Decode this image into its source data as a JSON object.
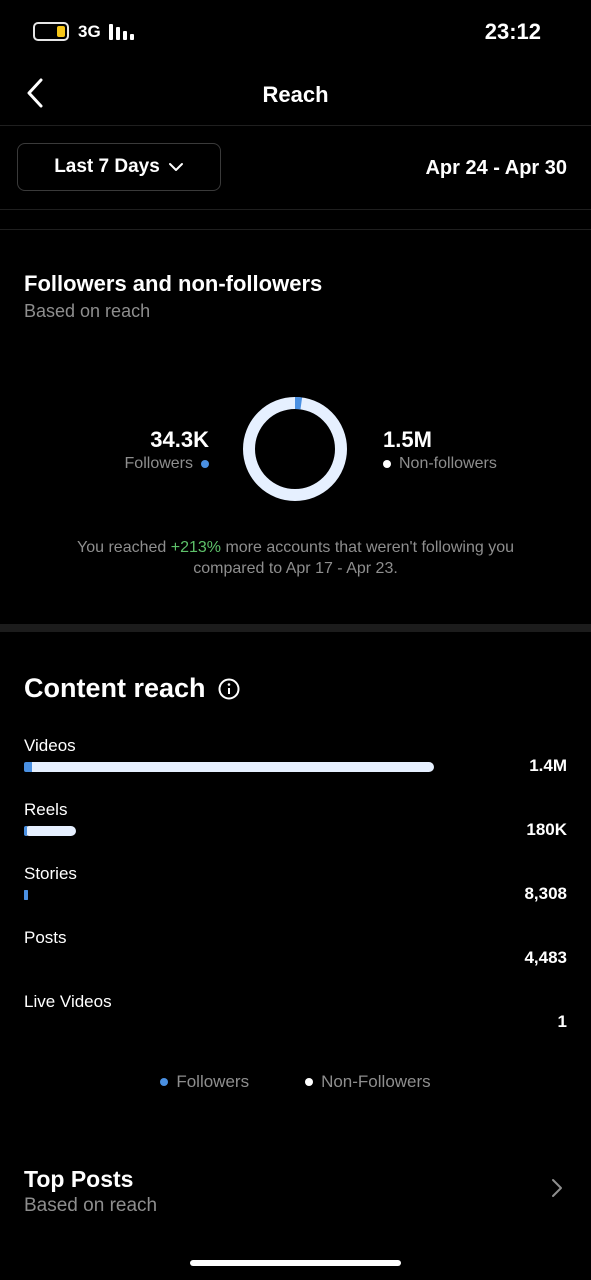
{
  "status_bar": {
    "network": "3G",
    "time": "23:12"
  },
  "header": {
    "title": "Reach"
  },
  "range": {
    "selector_label": "Last 7 Days",
    "dates": "Apr 24 - Apr 30"
  },
  "audience": {
    "title": "Followers and non-followers",
    "subtitle": "Based on reach",
    "followers_value": "34.3K",
    "followers_label": "Followers",
    "nonfollowers_value": "1.5M",
    "nonfollowers_label": "Non-followers",
    "followers_share": 0.022,
    "note_prefix": "You reached ",
    "note_change": "+213%",
    "note_suffix": " more accounts that weren't following you compared to Apr 17 - Apr 23."
  },
  "content_reach": {
    "title": "Content reach",
    "rows": [
      {
        "label": "Videos",
        "value": "1.4M",
        "total_fraction": 1.0,
        "followers_fraction": 0.02
      },
      {
        "label": "Reels",
        "value": "180K",
        "total_fraction": 0.127,
        "followers_fraction": 0.06
      },
      {
        "label": "Stories",
        "value": "8,308",
        "total_fraction": 0.006,
        "followers_fraction": 1.0
      },
      {
        "label": "Posts",
        "value": "4,483",
        "total_fraction": 0,
        "followers_fraction": 0
      },
      {
        "label": "Live Videos",
        "value": "1",
        "total_fraction": 0,
        "followers_fraction": 0
      }
    ],
    "legend_followers": "Followers",
    "legend_nonfollowers": "Non-Followers"
  },
  "top_posts": {
    "title": "Top Posts",
    "subtitle": "Based on reach"
  },
  "colors": {
    "followers": "#4a90e2",
    "nonfollowers": "#e6f0ff",
    "accent_positive": "#5ec26a"
  }
}
